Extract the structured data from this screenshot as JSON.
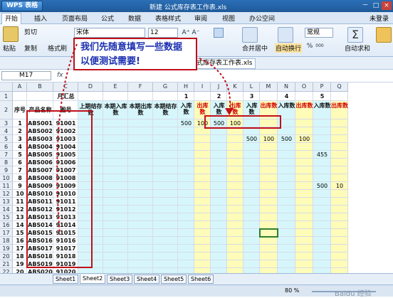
{
  "title_bar": {
    "app": "WPS 表格",
    "doc_title": "新建 公式库存表工作表.xls",
    "controls": [
      "－",
      "□",
      "×"
    ]
  },
  "menu": {
    "items": [
      "开始",
      "插入",
      "页面布局",
      "公式",
      "数据",
      "表格样式",
      "审阅",
      "视图",
      "办公空间"
    ],
    "login": "未登录"
  },
  "ribbon": {
    "paste": "粘贴",
    "cut": "剪切",
    "copy": "复制",
    "format_painter": "格式刷",
    "font": "宋体",
    "size": "12",
    "merge_center": "合并居中",
    "wrap": "自动换行",
    "autosum": "自动求和",
    "bold": "B",
    "italic": "I",
    "underline": "U",
    "grow": "A⁺",
    "shrink": "A⁻",
    "percent": "%",
    "thousand": "000",
    "dec_inc": "+.0 .00",
    "dec_dec": ".00 +.0",
    "format": "常规"
  },
  "quick": {
    "tab1": "新建",
    "tab2": "公式库存表工作表.xls"
  },
  "formula": {
    "namebox": "M17",
    "fx": "fx"
  },
  "callout": {
    "line1": "我们先随意填写一些数据",
    "line2": "以便测试需要!"
  },
  "columns": [
    "A",
    "B",
    "C",
    "D",
    "E",
    "F",
    "G",
    "H",
    "I",
    "J",
    "K",
    "L",
    "M",
    "N",
    "O",
    "P",
    "Q"
  ],
  "header": {
    "month_total": "月汇总",
    "seq": "序号",
    "product": "产品名称",
    "drawing": "图号",
    "prev_stock": "上期结存数",
    "in_qty": "本期入库数",
    "out_qty": "本期出库数",
    "cur_stock": "本期结存数",
    "day_in": "入库数",
    "day_out": "出库数",
    "days": [
      "1",
      "2",
      "3",
      "4",
      "5"
    ]
  },
  "rows": [
    {
      "n": "1",
      "p": "ABS001",
      "d": "91001"
    },
    {
      "n": "2",
      "p": "ABS002",
      "d": "91002"
    },
    {
      "n": "3",
      "p": "ABS003",
      "d": "91003"
    },
    {
      "n": "4",
      "p": "ABS004",
      "d": "91004"
    },
    {
      "n": "5",
      "p": "ABS005",
      "d": "91005"
    },
    {
      "n": "6",
      "p": "ABS006",
      "d": "91006"
    },
    {
      "n": "7",
      "p": "ABS007",
      "d": "91007"
    },
    {
      "n": "8",
      "p": "ABS008",
      "d": "91008"
    },
    {
      "n": "9",
      "p": "ABS009",
      "d": "91009"
    },
    {
      "n": "10",
      "p": "ABS010",
      "d": "91010"
    },
    {
      "n": "11",
      "p": "ABS011",
      "d": "91011"
    },
    {
      "n": "12",
      "p": "ABS012",
      "d": "91012"
    },
    {
      "n": "13",
      "p": "ABS013",
      "d": "91013"
    },
    {
      "n": "14",
      "p": "ABS014",
      "d": "91014"
    },
    {
      "n": "15",
      "p": "ABS015",
      "d": "91015"
    },
    {
      "n": "16",
      "p": "ABS016",
      "d": "91016"
    },
    {
      "n": "17",
      "p": "ABS017",
      "d": "91017"
    },
    {
      "n": "18",
      "p": "ABS018",
      "d": "91018"
    },
    {
      "n": "19",
      "p": "ABS019",
      "d": "91019"
    },
    {
      "n": "20",
      "p": "ABS020",
      "d": "91020"
    }
  ],
  "values": {
    "r3": [
      "500",
      "100",
      "500",
      "100"
    ],
    "r4": [
      "500",
      "100",
      "500",
      "100"
    ],
    "r6": "455",
    "r10": [
      "500",
      "10"
    ]
  },
  "row_numbers": [
    "1",
    "2",
    "3",
    "4",
    "5",
    "6",
    "7",
    "8",
    "9",
    "10",
    "11",
    "12",
    "13",
    "14",
    "15",
    "16",
    "17",
    "18",
    "19",
    "20",
    "21",
    "22"
  ],
  "sheets": [
    "Sheet1",
    "Sheet2",
    "Sheet3",
    "Sheet4",
    "Sheet5",
    "Sheet6"
  ],
  "status": {
    "zoom": "80 %",
    "watermark": "Baidu 经验"
  }
}
